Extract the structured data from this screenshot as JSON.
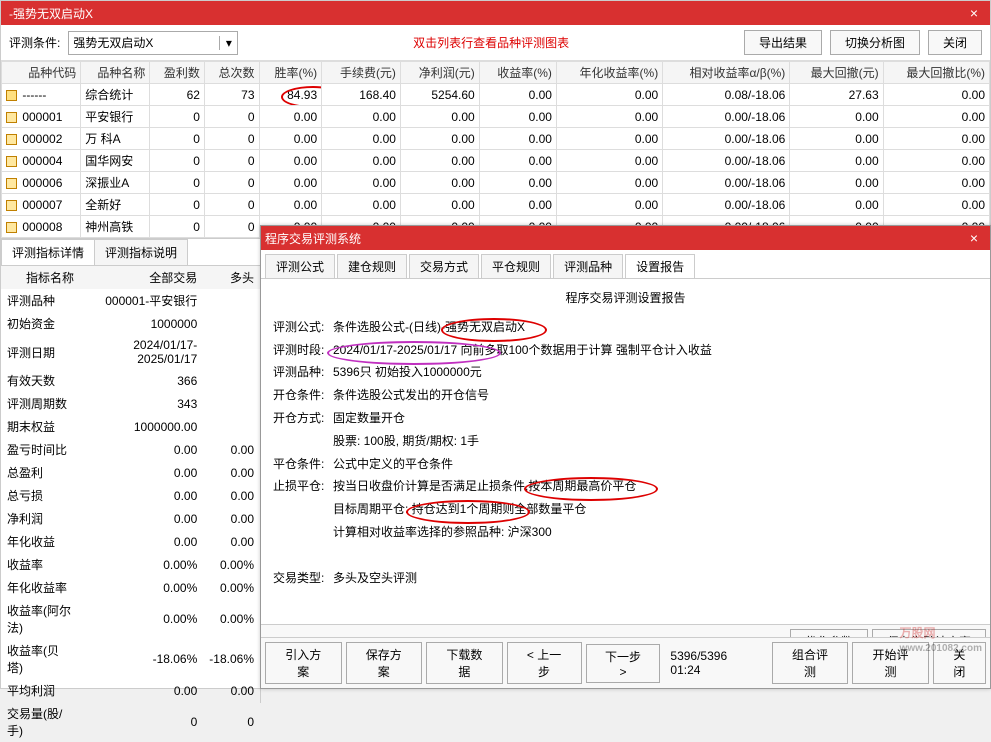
{
  "main_window": {
    "title": "-强势无双启动X",
    "close": "×"
  },
  "toolbar": {
    "condition_label": "评测条件:",
    "condition_value": "强势无双启动X",
    "hint_text": "双击列表行查看品种评测图表",
    "export_btn": "导出结果",
    "switch_btn": "切换分析图",
    "close_btn": "关闭"
  },
  "columns": [
    "品种代码",
    "品种名称",
    "盈利数",
    "总次数",
    "胜率(%)",
    "手续费(元)",
    "净利润(元)",
    "收益率(%)",
    "年化收益率(%)",
    "相对收益率α/β(%)",
    "最大回撤(元)",
    "最大回撤比(%)"
  ],
  "rows": [
    {
      "code": "------",
      "name": "综合统计",
      "win": "62",
      "total": "73",
      "rate": "84.93",
      "fee": "168.40",
      "profit": "5254.60",
      "ret": "0.00",
      "annual": "0.00",
      "rel": "0.08/-18.06",
      "dd": "27.63",
      "ddr": "0.00",
      "icon": "compose",
      "circle": true
    },
    {
      "code": "000001",
      "name": "平安银行",
      "win": "0",
      "total": "0",
      "rate": "0.00",
      "fee": "0.00",
      "profit": "0.00",
      "ret": "0.00",
      "annual": "0.00",
      "rel": "0.00/-18.06",
      "dd": "0.00",
      "ddr": "0.00"
    },
    {
      "code": "000002",
      "name": "万 科A",
      "win": "0",
      "total": "0",
      "rate": "0.00",
      "fee": "0.00",
      "profit": "0.00",
      "ret": "0.00",
      "annual": "0.00",
      "rel": "0.00/-18.06",
      "dd": "0.00",
      "ddr": "0.00"
    },
    {
      "code": "000004",
      "name": "国华网安",
      "win": "0",
      "total": "0",
      "rate": "0.00",
      "fee": "0.00",
      "profit": "0.00",
      "ret": "0.00",
      "annual": "0.00",
      "rel": "0.00/-18.06",
      "dd": "0.00",
      "ddr": "0.00"
    },
    {
      "code": "000006",
      "name": "深振业A",
      "win": "0",
      "total": "0",
      "rate": "0.00",
      "fee": "0.00",
      "profit": "0.00",
      "ret": "0.00",
      "annual": "0.00",
      "rel": "0.00/-18.06",
      "dd": "0.00",
      "ddr": "0.00"
    },
    {
      "code": "000007",
      "name": "全新好",
      "win": "0",
      "total": "0",
      "rate": "0.00",
      "fee": "0.00",
      "profit": "0.00",
      "ret": "0.00",
      "annual": "0.00",
      "rel": "0.00/-18.06",
      "dd": "0.00",
      "ddr": "0.00"
    },
    {
      "code": "000008",
      "name": "神州高铁",
      "win": "0",
      "total": "0",
      "rate": "0.00",
      "fee": "0.00",
      "profit": "0.00",
      "ret": "0.00",
      "annual": "0.00",
      "rel": "0.00/-18.06",
      "dd": "0.00",
      "ddr": "0.00"
    }
  ],
  "left_tabs": {
    "t1": "评测指标详情",
    "t2": "评测指标说明"
  },
  "detail_headers": [
    "指标名称",
    "全部交易",
    "多头"
  ],
  "details": [
    {
      "k": "评测品种",
      "v1": "000001-平安银行",
      "v2": ""
    },
    {
      "k": "初始资金",
      "v1": "1000000",
      "v2": ""
    },
    {
      "k": "评测日期",
      "v1": "2024/01/17-2025/01/17",
      "v2": ""
    },
    {
      "k": "有效天数",
      "v1": "366",
      "v2": ""
    },
    {
      "k": "评测周期数",
      "v1": "343",
      "v2": ""
    },
    {
      "k": "期末权益",
      "v1": "1000000.00",
      "v2": ""
    },
    {
      "k": "盈亏时间比",
      "v1": "0.00",
      "v2": "0.00"
    },
    {
      "k": "总盈利",
      "v1": "0.00",
      "v2": "0.00"
    },
    {
      "k": "总亏损",
      "v1": "0.00",
      "v2": "0.00"
    },
    {
      "k": "净利润",
      "v1": "0.00",
      "v2": "0.00"
    },
    {
      "k": "年化收益",
      "v1": "0.00",
      "v2": "0.00"
    },
    {
      "k": "收益率",
      "v1": "0.00%",
      "v2": "0.00%"
    },
    {
      "k": "年化收益率",
      "v1": "0.00%",
      "v2": "0.00%"
    },
    {
      "k": "收益率(阿尔法)",
      "v1": "0.00%",
      "v2": "0.00%"
    },
    {
      "k": "收益率(贝塔)",
      "v1": "-18.06%",
      "v2": "-18.06%"
    },
    {
      "k": "平均利润",
      "v1": "0.00",
      "v2": "0.00"
    },
    {
      "k": "交易量(股/手)",
      "v1": "0",
      "v2": "0"
    }
  ],
  "sub_window": {
    "title": "程序交易评测系统",
    "tabs": [
      "评测公式",
      "建仓规则",
      "交易方式",
      "平仓规则",
      "评测品种",
      "设置报告"
    ],
    "report_title": "程序交易评测设置报告",
    "lines": {
      "formula_k": "评测公式:",
      "formula_v_pre": "条件选股公式-(日线)-",
      "formula_v_mark": "强势无双启动X",
      "period_k": "评测时段:",
      "period_v_mark": "2024/01/17-2025/01/17",
      "period_v_post": " 向前多取100个数据用于计算 强制平仓计入收益",
      "product_k": "评测品种:",
      "product_v": "5396只 初始投入1000000元",
      "open_k": "开仓条件:",
      "open_v": "条件选股公式发出的开仓信号",
      "method_k": "开仓方式:",
      "method_v": "固定数量开仓",
      "qty_v": "股票: 100股, 期货/期权: 1手",
      "close_k": "平仓条件:",
      "close_v": "公式中定义的平仓条件",
      "stop_k": "止损平仓:",
      "stop_v_pre": "按当日收盘价计算是否满足止损条件,",
      "stop_v_mark": "按本周期最高价平仓",
      "tgt_v_pre": "目标周期平仓: ",
      "tgt_v_mark": "持仓达到1个周期",
      "tgt_v_post": "则全部数量平仓",
      "ref_v": "计算相对收益率选择的参照品种: 沪深300",
      "type_k": "交易类型:",
      "type_v": "多头及空头评测"
    },
    "buttons": {
      "optimize": "优化参数",
      "save_default": "保存为默认方案",
      "import": "引入方案",
      "save": "保存方案",
      "download": "下载数据",
      "prev": "< 上一步",
      "next": "下一步 >",
      "status": "5396/5396 01:24",
      "combo": "组合评测",
      "start": "开始评测",
      "close": "关闭"
    },
    "watermark": "万股网",
    "watermark_url": "www.201082.com"
  }
}
